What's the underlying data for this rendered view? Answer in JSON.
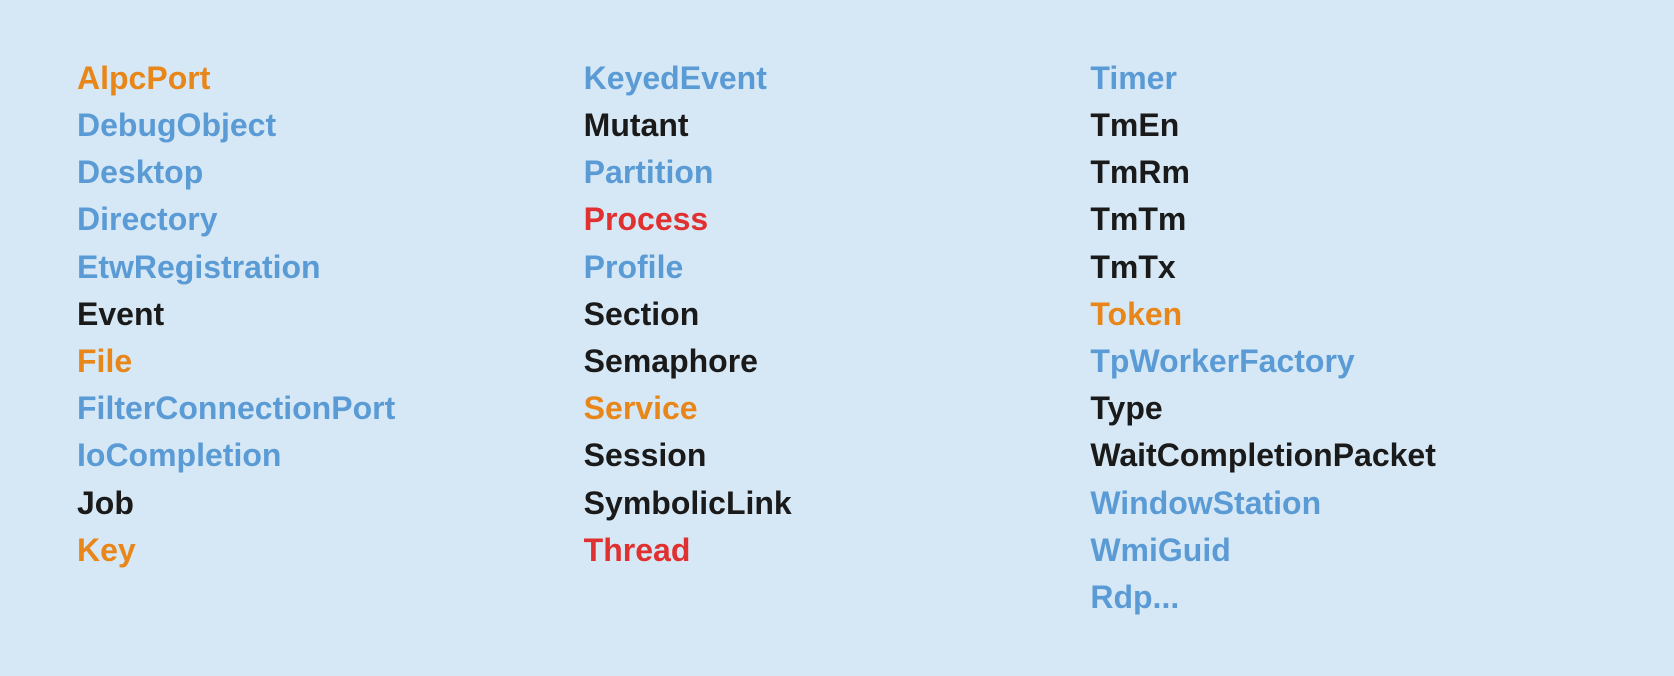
{
  "columns": [
    {
      "id": "col1",
      "items": [
        {
          "label": "AlpcPort",
          "color": "orange"
        },
        {
          "label": "DebugObject",
          "color": "blue"
        },
        {
          "label": "Desktop",
          "color": "blue"
        },
        {
          "label": "Directory",
          "color": "blue"
        },
        {
          "label": "EtwRegistration",
          "color": "blue"
        },
        {
          "label": "Event",
          "color": "black"
        },
        {
          "label": "File",
          "color": "orange"
        },
        {
          "label": "FilterConnectionPort",
          "color": "blue"
        },
        {
          "label": "IoCompletion",
          "color": "blue"
        },
        {
          "label": "Job",
          "color": "black"
        },
        {
          "label": "Key",
          "color": "orange"
        }
      ]
    },
    {
      "id": "col2",
      "items": [
        {
          "label": "KeyedEvent",
          "color": "blue"
        },
        {
          "label": "Mutant",
          "color": "black"
        },
        {
          "label": "Partition",
          "color": "blue"
        },
        {
          "label": "Process",
          "color": "red"
        },
        {
          "label": "Profile",
          "color": "blue"
        },
        {
          "label": "Section",
          "color": "black"
        },
        {
          "label": "Semaphore",
          "color": "black"
        },
        {
          "label": "Service",
          "color": "orange"
        },
        {
          "label": "Session",
          "color": "black"
        },
        {
          "label": "SymbolicLink",
          "color": "black"
        },
        {
          "label": "Thread",
          "color": "red"
        }
      ]
    },
    {
      "id": "col3",
      "items": [
        {
          "label": "Timer",
          "color": "blue"
        },
        {
          "label": "TmEn",
          "color": "black"
        },
        {
          "label": "TmRm",
          "color": "black"
        },
        {
          "label": "TmTm",
          "color": "black"
        },
        {
          "label": "TmTx",
          "color": "black"
        },
        {
          "label": "Token",
          "color": "orange"
        },
        {
          "label": "TpWorkerFactory",
          "color": "blue"
        },
        {
          "label": "Type",
          "color": "black"
        },
        {
          "label": "WaitCompletionPacket",
          "color": "black"
        },
        {
          "label": "WindowStation",
          "color": "blue"
        },
        {
          "label": "WmiGuid",
          "color": "blue"
        },
        {
          "label": "Rdp...",
          "color": "blue"
        }
      ]
    }
  ],
  "colorMap": {
    "orange": "#e8861a",
    "blue": "#5b9bd5",
    "red": "#e03030",
    "black": "#1a1a1a"
  }
}
